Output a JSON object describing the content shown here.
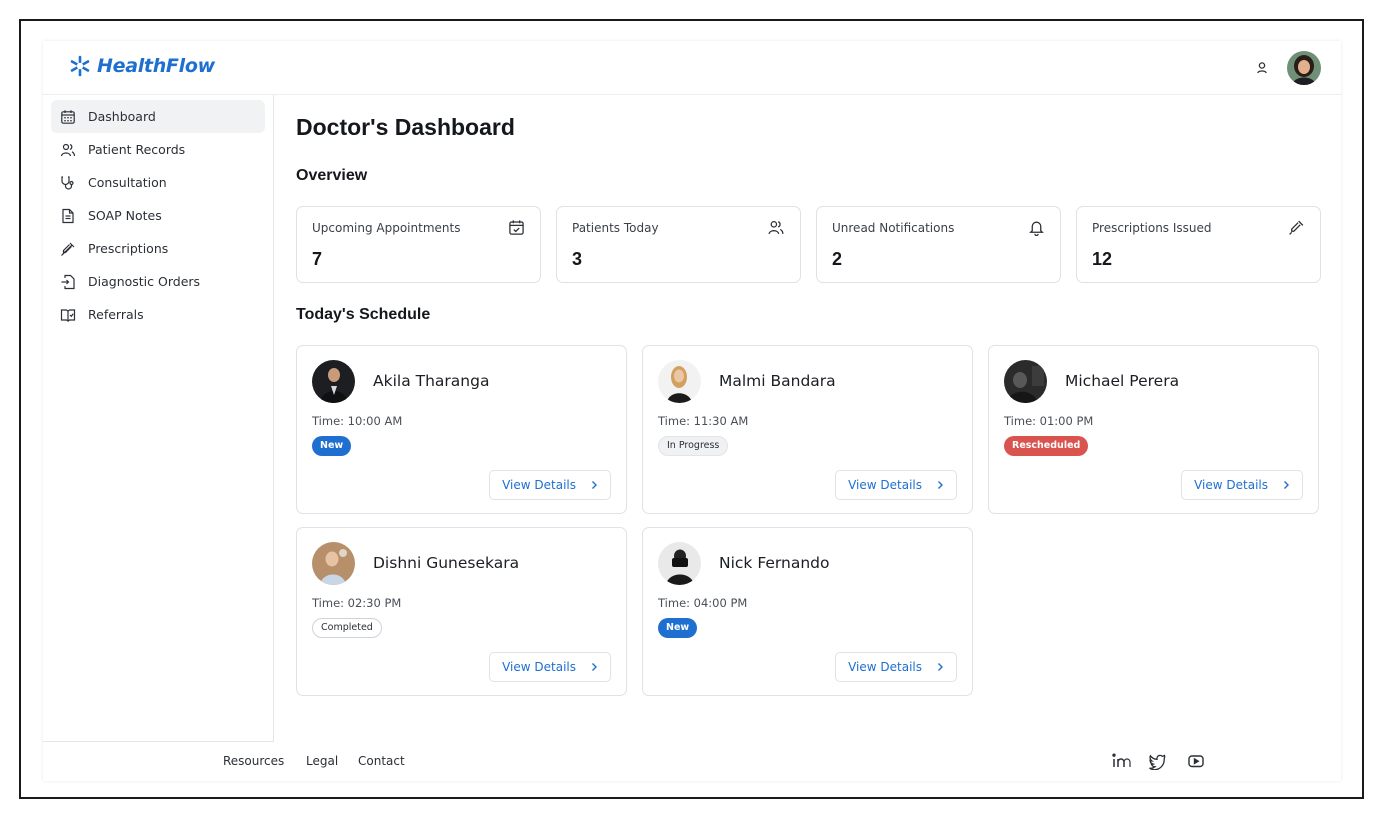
{
  "header": {
    "logo_text": "HealthFlow",
    "brand_color": "#1e6fcf"
  },
  "sidebar": {
    "items": [
      {
        "label": "Dashboard",
        "icon": "calendar-icon",
        "active": true
      },
      {
        "label": "Patient Records",
        "icon": "users-icon",
        "active": false
      },
      {
        "label": "Consultation",
        "icon": "stethoscope-icon",
        "active": false
      },
      {
        "label": "SOAP Notes",
        "icon": "document-icon",
        "active": false
      },
      {
        "label": "Prescriptions",
        "icon": "syringe-icon",
        "active": false
      },
      {
        "label": "Diagnostic Orders",
        "icon": "file-export-icon",
        "active": false
      },
      {
        "label": "Referrals",
        "icon": "book-check-icon",
        "active": false
      }
    ]
  },
  "main": {
    "title": "Doctor's Dashboard",
    "overview_title": "Overview",
    "schedule_title": "Today's Schedule",
    "stats": [
      {
        "label": "Upcoming Appointments",
        "value": "7",
        "icon": "calendar-check-icon"
      },
      {
        "label": "Patients Today",
        "value": "3",
        "icon": "users-icon"
      },
      {
        "label": "Unread Notifications",
        "value": "2",
        "icon": "bell-icon"
      },
      {
        "label": "Prescriptions Issued",
        "value": "12",
        "icon": "syringe-icon"
      }
    ],
    "appointments": [
      {
        "name": "Akila Tharanga",
        "time": "Time: 10:00 AM",
        "status": "New",
        "status_color": "#1e6fcf",
        "button": "View Details"
      },
      {
        "name": "Malmi Bandara",
        "time": "Time: 11:30 AM",
        "status": "In Progress",
        "status_color": "#f0f1f3",
        "button": "View Details"
      },
      {
        "name": "Michael Perera",
        "time": "Time: 01:00 PM",
        "status": "Rescheduled",
        "status_color": "#d9534f",
        "button": "View Details"
      },
      {
        "name": "Dishni Gunesekara",
        "time": "Time: 02:30 PM",
        "status": "Completed",
        "status_color": "#ffffff",
        "button": "View Details"
      },
      {
        "name": "Nick Fernando",
        "time": "Time: 04:00 PM",
        "status": "New",
        "status_color": "#1e6fcf",
        "button": "View Details"
      }
    ]
  },
  "footer": {
    "links": [
      "Resources",
      "Legal",
      "Contact"
    ],
    "social": [
      "linkedin-icon",
      "twitter-icon",
      "youtube-icon"
    ]
  }
}
